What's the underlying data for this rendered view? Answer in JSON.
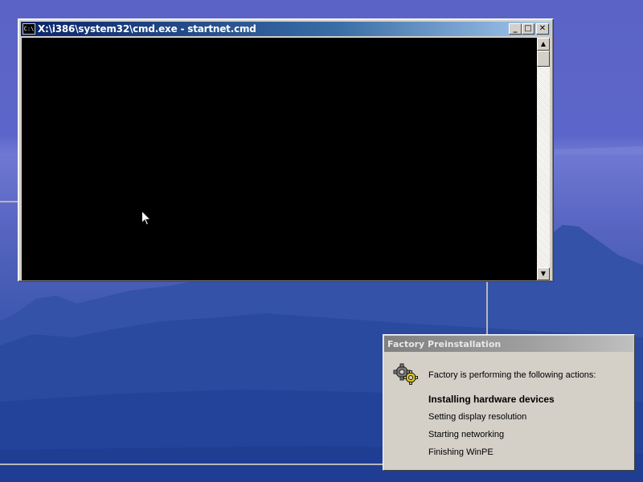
{
  "cmd_window": {
    "title": "X:\\i386\\system32\\cmd.exe - startnet.cmd",
    "icon": "C:\\",
    "buttons": {
      "minimize": "_",
      "maximize": "□",
      "close": "✕"
    },
    "scroll_up": "▲",
    "scroll_down": "▼"
  },
  "factory_dialog": {
    "title": "Factory Preinstallation",
    "intro": "Factory is performing the following actions:",
    "steps": [
      "Installing hardware devices",
      "Setting display resolution",
      "Starting networking",
      "Finishing WinPE"
    ]
  }
}
